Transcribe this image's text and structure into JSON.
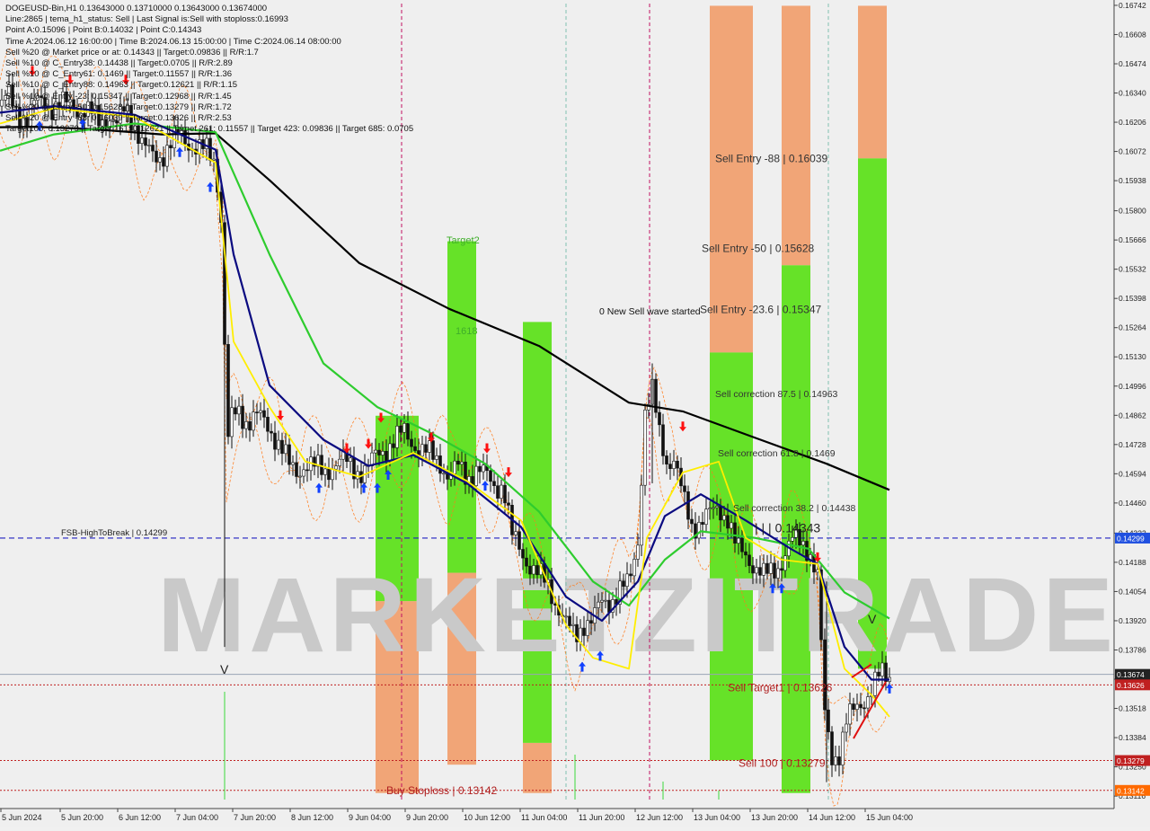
{
  "header": {
    "lines": [
      "DOGEUSD-Bin,H1  0.13643000 0.13710000 0.13643000 0.13674000",
      "Line:2865 | tema_h1_status: Sell | Last Signal is:Sell with stoploss:0.16993",
      "Point A:0.15096 | Point B:0.14032 | Point C:0.14343",
      "Time A:2024.06.12 16:00:00 | Time B:2024.06.13 15:00:00 | Time C:2024.06.14 08:00:00",
      "Sell %20 @ Market price or at: 0.14343 || Target:0.09836 || R/R:1.7",
      "Sell %10 @ C_Entry38: 0.14438 || Target:0.0705 || R/R:2.89",
      "Sell %10 @ C_Entry61: 0.1469 || Target:0.11557 || R/R:1.36",
      "Sell %10 @ C_Entry88: 0.14963 || Target:0.12621 || R/R:1.15",
      "Sell %10 @ Entry -23: 0.15347 || Target:0.12968 || R/R:1.45",
      "Sell %20 @ Entry -50: 0.15628 || Target:0.13279 || R/R:1.72",
      "Sell %20 @ Entry -88: 0.16039 || Target:0.13626 || R/R:2.53",
      "Target100: 0.13279 || Target 161: 0.12621 || Target 261: 0.11557 || Target 423: 0.09836 || Target 685: 0.0705"
    ]
  },
  "watermark": "MARKETZITRADE",
  "chart_labels": {
    "target2": "Target2",
    "l1618": "1618",
    "new_wave": "0 New Sell wave started",
    "entry88": "Sell Entry -88 | 0.16039",
    "entry50": "Sell Entry -50 | 0.15628",
    "entry23": "Sell Entry -23.6 | 0.15347",
    "corr875": "Sell correction 87.5 | 0.14963",
    "corr618": "Sell correction 61.8 | 0.1469",
    "corr382": "Sell correction 38.2 | 0.14438",
    "point_c": "| | | 0.14343",
    "fsb": "FSB-HighToBreak | 0.14299",
    "target1": "Sell Target1 | 0.13626",
    "sell100": "Sell 100 | 0.13279",
    "stoploss": "Buy Stoploss | 0.13142",
    "v_mark": "V"
  },
  "colors": {
    "background": "#efefef",
    "green_zone": "#5ee01c",
    "orange_zone": "#f0a070",
    "ma_black": "#000000",
    "ma_green": "#2ecc2e",
    "ma_navy": "#0a0a80",
    "ma_yellow": "#ffee00",
    "dashed_blue": "#2020c0",
    "dashed_red": "#c02020",
    "vline_magenta": "#c01060",
    "vline_teal": "#80c0b0",
    "up_arrow": "#1040ff",
    "down_arrow": "#ff1010",
    "price_badge_current": "#222222",
    "price_badge_fsb": "#2050e0",
    "price_badge_red": "#c02020",
    "price_badge_orange": "#ff6a00"
  },
  "chart_data": {
    "type": "candlestick",
    "symbol": "DOGEUSD-Bin",
    "timeframe": "H1",
    "ylim": [
      0.131,
      0.1675
    ],
    "y_ticks": [
      "0.16742",
      "0.16608",
      "0.16474",
      "0.16340",
      "0.16206",
      "0.16072",
      "0.15938",
      "0.15800",
      "0.15666",
      "0.15532",
      "0.15398",
      "0.15264",
      "0.15130",
      "0.14996",
      "0.14862",
      "0.14728",
      "0.14594",
      "0.14460",
      "0.14322",
      "0.14188",
      "0.14054",
      "0.13920",
      "0.13786",
      "0.13652",
      "0.13518",
      "0.13384",
      "0.13250",
      "0.13116"
    ],
    "x_ticks": [
      "5 Jun 2024",
      "5 Jun 20:00",
      "6 Jun 12:00",
      "7 Jun 04:00",
      "7 Jun 20:00",
      "8 Jun 12:00",
      "9 Jun 04:00",
      "9 Jun 20:00",
      "10 Jun 12:00",
      "11 Jun 04:00",
      "11 Jun 20:00",
      "12 Jun 12:00",
      "13 Jun 04:00",
      "13 Jun 20:00",
      "14 Jun 12:00",
      "15 Jun 04:00"
    ],
    "close_path": [
      [
        0,
        0.1628
      ],
      [
        10,
        0.1632
      ],
      [
        20,
        0.1625
      ],
      [
        30,
        0.1622
      ],
      [
        40,
        0.1629
      ],
      [
        50,
        0.1631
      ],
      [
        60,
        0.1627
      ],
      [
        70,
        0.1628
      ],
      [
        80,
        0.163
      ],
      [
        90,
        0.1626
      ],
      [
        100,
        0.1624
      ],
      [
        110,
        0.1622
      ],
      [
        120,
        0.1624
      ],
      [
        130,
        0.1618
      ],
      [
        140,
        0.1628
      ],
      [
        150,
        0.162
      ],
      [
        160,
        0.1608
      ],
      [
        170,
        0.1605
      ],
      [
        180,
        0.1606
      ],
      [
        190,
        0.161
      ],
      [
        200,
        0.1615
      ],
      [
        210,
        0.1612
      ],
      [
        220,
        0.1608
      ],
      [
        230,
        0.1607
      ],
      [
        240,
        0.1603
      ],
      [
        248,
        0.1568
      ],
      [
        252,
        0.147
      ],
      [
        258,
        0.1484
      ],
      [
        265,
        0.1488
      ],
      [
        275,
        0.1484
      ],
      [
        285,
        0.1486
      ],
      [
        295,
        0.1482
      ],
      [
        305,
        0.1478
      ],
      [
        315,
        0.147
      ],
      [
        322,
        0.1462
      ],
      [
        330,
        0.146
      ],
      [
        340,
        0.1465
      ],
      [
        350,
        0.1462
      ],
      [
        360,
        0.146
      ],
      [
        370,
        0.1464
      ],
      [
        380,
        0.1465
      ],
      [
        390,
        0.1463
      ],
      [
        400,
        0.1461
      ],
      [
        410,
        0.1462
      ],
      [
        420,
        0.1468
      ],
      [
        430,
        0.1472
      ],
      [
        440,
        0.1475
      ],
      [
        450,
        0.1478
      ],
      [
        460,
        0.1474
      ],
      [
        470,
        0.147
      ],
      [
        480,
        0.1467
      ],
      [
        490,
        0.1465
      ],
      [
        500,
        0.1458
      ],
      [
        510,
        0.1462
      ],
      [
        520,
        0.1458
      ],
      [
        530,
        0.1462
      ],
      [
        540,
        0.1458
      ],
      [
        550,
        0.1454
      ],
      [
        560,
        0.1455
      ],
      [
        570,
        0.143
      ],
      [
        580,
        0.1424
      ],
      [
        590,
        0.1418
      ],
      [
        600,
        0.1412
      ],
      [
        610,
        0.1408
      ],
      [
        620,
        0.14
      ],
      [
        630,
        0.139
      ],
      [
        640,
        0.1384
      ],
      [
        650,
        0.1392
      ],
      [
        660,
        0.1392
      ],
      [
        670,
        0.14
      ],
      [
        680,
        0.1402
      ],
      [
        690,
        0.1406
      ],
      [
        700,
        0.1408
      ],
      [
        710,
        0.143
      ],
      [
        718,
        0.1488
      ],
      [
        726,
        0.1496
      ],
      [
        734,
        0.1478
      ],
      [
        742,
        0.1466
      ],
      [
        750,
        0.1466
      ],
      [
        760,
        0.1448
      ],
      [
        770,
        0.1436
      ],
      [
        780,
        0.1438
      ],
      [
        790,
        0.144
      ],
      [
        800,
        0.1444
      ],
      [
        810,
        0.144
      ],
      [
        820,
        0.1424
      ],
      [
        830,
        0.1422
      ],
      [
        840,
        0.1418
      ],
      [
        850,
        0.1412
      ],
      [
        860,
        0.1414
      ],
      [
        870,
        0.142
      ],
      [
        880,
        0.1428
      ],
      [
        890,
        0.1428
      ],
      [
        900,
        0.1426
      ],
      [
        910,
        0.1412
      ],
      [
        918,
        0.1348
      ],
      [
        926,
        0.133
      ],
      [
        934,
        0.1332
      ],
      [
        942,
        0.1345
      ],
      [
        950,
        0.135
      ],
      [
        960,
        0.1356
      ],
      [
        970,
        0.136
      ],
      [
        980,
        0.1367
      ],
      [
        990,
        0.1367
      ]
    ],
    "ma_black": [
      [
        0,
        0.16183
      ],
      [
        40,
        0.16185
      ],
      [
        100,
        0.16175
      ],
      [
        180,
        0.1615
      ],
      [
        240,
        0.16155
      ],
      [
        300,
        0.1594
      ],
      [
        400,
        0.1556
      ],
      [
        500,
        0.1535
      ],
      [
        600,
        0.1518
      ],
      [
        700,
        0.1492
      ],
      [
        760,
        0.1488
      ],
      [
        840,
        0.1476
      ],
      [
        920,
        0.1464
      ],
      [
        990,
        0.1452
      ]
    ],
    "ma_green": [
      [
        0,
        0.16075
      ],
      [
        60,
        0.1615
      ],
      [
        150,
        0.162
      ],
      [
        240,
        0.1616
      ],
      [
        300,
        0.156
      ],
      [
        360,
        0.151
      ],
      [
        420,
        0.149
      ],
      [
        480,
        0.1478
      ],
      [
        540,
        0.1464
      ],
      [
        600,
        0.1442
      ],
      [
        660,
        0.141
      ],
      [
        700,
        0.1399
      ],
      [
        740,
        0.142
      ],
      [
        780,
        0.1433
      ],
      [
        840,
        0.143
      ],
      [
        900,
        0.1425
      ],
      [
        940,
        0.1405
      ],
      [
        990,
        0.1393
      ]
    ],
    "ma_navy": [
      [
        0,
        0.1625
      ],
      [
        60,
        0.1628
      ],
      [
        150,
        0.1624
      ],
      [
        240,
        0.1608
      ],
      [
        260,
        0.156
      ],
      [
        300,
        0.15
      ],
      [
        360,
        0.1475
      ],
      [
        410,
        0.1463
      ],
      [
        460,
        0.1468
      ],
      [
        520,
        0.1455
      ],
      [
        580,
        0.1435
      ],
      [
        630,
        0.1403
      ],
      [
        670,
        0.1392
      ],
      [
        710,
        0.141
      ],
      [
        740,
        0.144
      ],
      [
        780,
        0.145
      ],
      [
        830,
        0.1438
      ],
      [
        880,
        0.1425
      ],
      [
        910,
        0.1418
      ],
      [
        940,
        0.138
      ],
      [
        970,
        0.1365
      ],
      [
        990,
        0.1365
      ]
    ],
    "ma_yellow": [
      [
        0,
        0.162
      ],
      [
        60,
        0.1627
      ],
      [
        150,
        0.1623
      ],
      [
        240,
        0.1602
      ],
      [
        260,
        0.152
      ],
      [
        300,
        0.149
      ],
      [
        340,
        0.1465
      ],
      [
        400,
        0.1458
      ],
      [
        460,
        0.1469
      ],
      [
        520,
        0.1456
      ],
      [
        580,
        0.1438
      ],
      [
        630,
        0.139
      ],
      [
        660,
        0.1375
      ],
      [
        700,
        0.137
      ],
      [
        720,
        0.143
      ],
      [
        760,
        0.146
      ],
      [
        800,
        0.1465
      ],
      [
        830,
        0.143
      ],
      [
        870,
        0.142
      ],
      [
        910,
        0.1418
      ],
      [
        940,
        0.137
      ],
      [
        970,
        0.1358
      ],
      [
        990,
        0.1348
      ]
    ],
    "fib_levels": [
      {
        "name": "Sell Entry -88",
        "value": 0.16039
      },
      {
        "name": "Sell Entry -50",
        "value": 0.15628
      },
      {
        "name": "Sell Entry -23.6",
        "value": 0.15347
      },
      {
        "name": "Sell correction 87.5",
        "value": 0.14963
      },
      {
        "name": "Sell correction 61.8",
        "value": 0.1469
      },
      {
        "name": "Sell correction 38.2",
        "value": 0.14438
      },
      {
        "name": "Point C",
        "value": 0.14343
      },
      {
        "name": "FSB-HighToBreak",
        "value": 0.14299
      },
      {
        "name": "Sell Target1",
        "value": 0.13626
      },
      {
        "name": "Sell 100",
        "value": 0.13279
      },
      {
        "name": "Buy Stoploss",
        "value": 0.13142
      }
    ],
    "price_badges": [
      {
        "value": "0.13674",
        "kind": "current"
      },
      {
        "value": "0.14299",
        "kind": "fsb"
      },
      {
        "value": "0.13626",
        "kind": "red"
      },
      {
        "value": "0.13279",
        "kind": "red"
      },
      {
        "value": "0.13142",
        "kind": "orange"
      }
    ],
    "zones": [
      {
        "x": [
          418,
          466
        ],
        "y": [
          0.1313,
          0.1401
        ],
        "color": "orange"
      },
      {
        "x": [
          418,
          466
        ],
        "y": [
          0.1401,
          0.1486
        ],
        "color": "green"
      },
      {
        "x": [
          498,
          530
        ],
        "y": [
          0.1326,
          0.1414
        ],
        "color": "orange"
      },
      {
        "x": [
          498,
          530
        ],
        "y": [
          0.1414,
          0.1566
        ],
        "color": "green"
      },
      {
        "x": [
          582,
          614
        ],
        "y": [
          0.1313,
          0.1336
        ],
        "color": "orange"
      },
      {
        "x": [
          582,
          614
        ],
        "y": [
          0.1336,
          0.1529
        ],
        "color": "green"
      },
      {
        "x": [
          790,
          838
        ],
        "y": [
          0.1515,
          0.1674
        ],
        "color": "orange"
      },
      {
        "x": [
          790,
          838
        ],
        "y": [
          0.1328,
          0.1515
        ],
        "color": "green"
      },
      {
        "x": [
          870,
          902
        ],
        "y": [
          0.1313,
          0.1674
        ],
        "color": "orange_green"
      },
      {
        "x": [
          955,
          987
        ],
        "y": [
          0.1604,
          0.1674
        ],
        "color": "orange"
      },
      {
        "x": [
          955,
          987
        ],
        "y": [
          0.137,
          0.1604
        ],
        "color": "green"
      }
    ],
    "up_arrows": [
      [
        44,
        0.1622
      ],
      [
        92,
        0.1623
      ],
      [
        200,
        0.161
      ],
      [
        234,
        0.1594
      ],
      [
        355,
        0.1456
      ],
      [
        405,
        0.1456
      ],
      [
        420,
        0.1456
      ],
      [
        432,
        0.1462
      ],
      [
        540,
        0.1457
      ],
      [
        648,
        0.1374
      ],
      [
        668,
        0.1379
      ],
      [
        860,
        0.141
      ],
      [
        870,
        0.141
      ],
      [
        990,
        0.1364
      ]
    ],
    "down_arrows": [
      [
        36,
        0.1641
      ],
      [
        78,
        0.1637
      ],
      [
        140,
        0.1637
      ],
      [
        312,
        0.1483
      ],
      [
        386,
        0.1468
      ],
      [
        410,
        0.147
      ],
      [
        424,
        0.1482
      ],
      [
        480,
        0.1473
      ],
      [
        542,
        0.1468
      ],
      [
        566,
        0.1457
      ],
      [
        760,
        0.1478
      ],
      [
        910,
        0.1418
      ]
    ]
  }
}
